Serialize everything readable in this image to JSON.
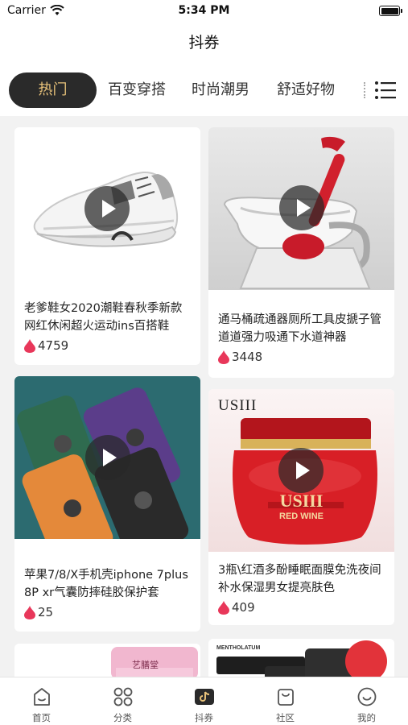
{
  "status_bar": {
    "carrier": "Carrier",
    "time": "5:34 PM"
  },
  "header": {
    "title": "抖券"
  },
  "category_tabs": [
    {
      "label": "热门",
      "active": true
    },
    {
      "label": "百变穿搭",
      "active": false
    },
    {
      "label": "时尚潮男",
      "active": false
    },
    {
      "label": "舒适好物",
      "active": false
    }
  ],
  "products": [
    {
      "title": "老爹鞋女2020潮鞋春秋季新款网红休闲超火运动ins百搭鞋",
      "likes": "4759",
      "image": "sneaker"
    },
    {
      "title": "通马桶疏通器厕所工具皮搋子管道道强力吸通下水道神器",
      "likes": "3448",
      "image": "toilet-plunger"
    },
    {
      "title": "苹果7/8/X手机壳iphone 7plus 8P xr气囊防摔硅胶保护套",
      "likes": "25",
      "image": "phone-cases"
    },
    {
      "title": "3瓶\\红酒多酚睡眠面膜免洗夜间补水保湿男女提亮肤色",
      "likes": "409",
      "image": "red-wine-mask",
      "image_text": {
        "brand": "USIII",
        "jar_brand": "USIII",
        "jar_sub": "RED WINE"
      }
    },
    {
      "title": "",
      "likes": "",
      "image": "pink-jar",
      "image_text": {
        "label": "艺膳堂"
      }
    },
    {
      "title": "",
      "likes": "",
      "image": "black-tubes",
      "image_text": {
        "label": "MENTHOLATUM"
      }
    }
  ],
  "bottom_tabs": [
    {
      "label": "首页",
      "icon": "home-icon",
      "active": false
    },
    {
      "label": "分类",
      "icon": "category-icon",
      "active": false
    },
    {
      "label": "抖券",
      "icon": "douquan-icon",
      "active": true
    },
    {
      "label": "社区",
      "icon": "community-bag-icon",
      "active": false
    },
    {
      "label": "我的",
      "icon": "profile-smile-icon",
      "active": false
    }
  ],
  "colors": {
    "accent_gold": "#e8c27a",
    "tab_active_bg": "#2a2a2a",
    "likes_red": "#e8375a"
  }
}
